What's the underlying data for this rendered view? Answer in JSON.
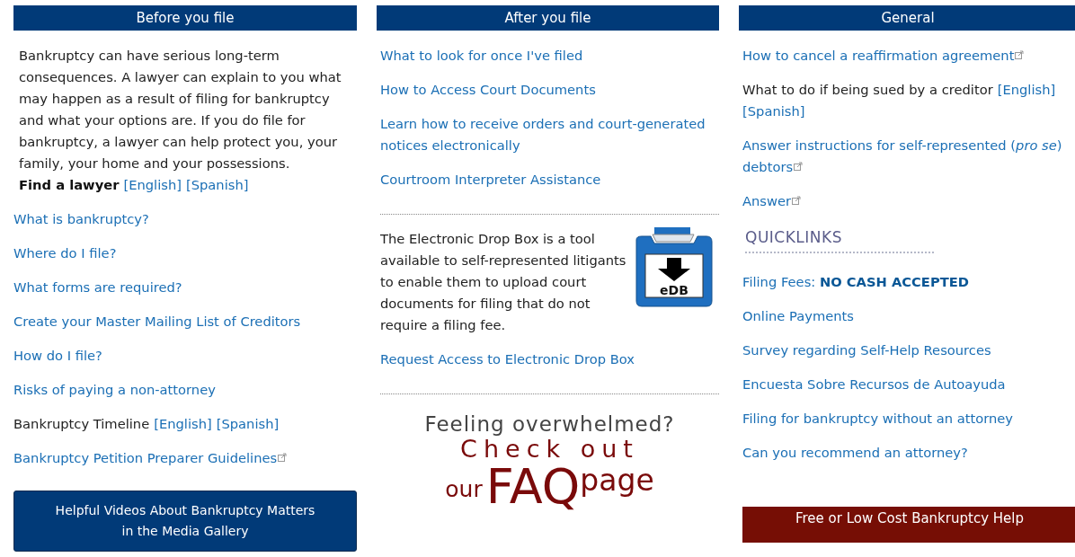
{
  "columns": [
    {
      "title": "Before you file",
      "blocks": [
        {
          "kind": "paragraph",
          "text": "Bankruptcy can have serious long-term consequences. A lawyer can explain to you what may happen as a result of filing for bankruptcy and what your options are. If you do file for bankruptcy, a lawyer can help protect you, your family, your home and your possessions."
        },
        {
          "kind": "line",
          "parts": [
            {
              "kind": "bold",
              "text": "Find a lawyer"
            },
            {
              "kind": "link",
              "text": "[English]"
            },
            {
              "kind": "link",
              "text": "[Spanish]"
            }
          ]
        },
        {
          "kind": "line",
          "parts": [
            {
              "kind": "link",
              "text": "What is bankruptcy?"
            }
          ]
        },
        {
          "kind": "line",
          "parts": [
            {
              "kind": "link",
              "text": "Where do I file?"
            }
          ]
        },
        {
          "kind": "line",
          "parts": [
            {
              "kind": "link",
              "text": "What forms are required?"
            }
          ]
        },
        {
          "kind": "line",
          "parts": [
            {
              "kind": "link",
              "text": "Create your Master Mailing List of Creditors"
            }
          ]
        },
        {
          "kind": "line",
          "parts": [
            {
              "kind": "link",
              "text": "How do I file?"
            }
          ]
        },
        {
          "kind": "line",
          "parts": [
            {
              "kind": "link",
              "text": "Risks of paying a non-attorney"
            }
          ]
        },
        {
          "kind": "line",
          "parts": [
            {
              "kind": "text",
              "text": "Bankruptcy Timeline"
            },
            {
              "kind": "link",
              "text": "[English]"
            },
            {
              "kind": "link",
              "text": "[Spanish]"
            }
          ]
        },
        {
          "kind": "line",
          "parts": [
            {
              "kind": "link",
              "text": "Bankruptcy Petition Preparer Guidelines",
              "external": true
            }
          ]
        },
        {
          "kind": "button",
          "lines": [
            "Helpful Videos About Bankruptcy Matters",
            "in the Media Gallery"
          ]
        }
      ]
    },
    {
      "title": "After you file",
      "blocks": [
        {
          "kind": "line",
          "parts": [
            {
              "kind": "link",
              "text": "What to look for once I've filed"
            }
          ]
        },
        {
          "kind": "line",
          "parts": [
            {
              "kind": "link",
              "text": "How to Access Court Documents"
            }
          ]
        },
        {
          "kind": "line",
          "parts": [
            {
              "kind": "link",
              "text": "Learn how to receive orders and court-generated notices electronically"
            }
          ]
        },
        {
          "kind": "line",
          "parts": [
            {
              "kind": "link",
              "text": "Courtroom Interpreter Assistance"
            }
          ]
        },
        {
          "kind": "divider"
        },
        {
          "kind": "dropbox",
          "text": "The Electronic Drop Box is a tool available to self-represented litigants to enable them to upload court documents for filing that do not require a filing fee.",
          "icon_label": "eDB"
        },
        {
          "kind": "line",
          "parts": [
            {
              "kind": "link",
              "text": "Request Access to Electronic Drop Box"
            }
          ]
        },
        {
          "kind": "divider"
        },
        {
          "kind": "faq",
          "line1": "Feeling overwhelmed?",
          "line2": "Check out",
          "our": "our",
          "faq": "FAQ",
          "page": "page"
        }
      ]
    },
    {
      "title": "General",
      "blocks": [
        {
          "kind": "line",
          "parts": [
            {
              "kind": "link",
              "text": "How to cancel a reaffirmation agreement",
              "external": true
            }
          ]
        },
        {
          "kind": "line",
          "parts": [
            {
              "kind": "text",
              "text": "What to do if being sued by a creditor"
            },
            {
              "kind": "link",
              "text": "[English]"
            },
            {
              "kind": "link",
              "text": "[Spanish]"
            }
          ]
        },
        {
          "kind": "line",
          "parts": [
            {
              "kind": "link",
              "text": "Answer instructions for self-represented (*pro se*) debtors",
              "external": true
            }
          ]
        },
        {
          "kind": "line",
          "parts": [
            {
              "kind": "link",
              "text": "Answer",
              "external": true
            }
          ]
        },
        {
          "kind": "heading",
          "text": "QUICKLINKS"
        },
        {
          "kind": "line",
          "parts": [
            {
              "kind": "link",
              "text": "Filing Fees: **NO CASH ACCEPTED**"
            }
          ]
        },
        {
          "kind": "line",
          "parts": [
            {
              "kind": "link",
              "text": "Online Payments"
            }
          ]
        },
        {
          "kind": "line",
          "parts": [
            {
              "kind": "link",
              "text": "Survey regarding Self-Help Resources"
            }
          ]
        },
        {
          "kind": "line",
          "parts": [
            {
              "kind": "link",
              "text": "Encuesta Sobre Recursos de Autoayuda"
            }
          ]
        },
        {
          "kind": "line",
          "parts": [
            {
              "kind": "link",
              "text": "Filing for bankruptcy without an attorney"
            }
          ]
        },
        {
          "kind": "line",
          "parts": [
            {
              "kind": "link",
              "text": "Can you recommend an attorney?"
            }
          ]
        },
        {
          "kind": "banner",
          "text": "Free or Low Cost Bankruptcy Help"
        }
      ]
    }
  ]
}
